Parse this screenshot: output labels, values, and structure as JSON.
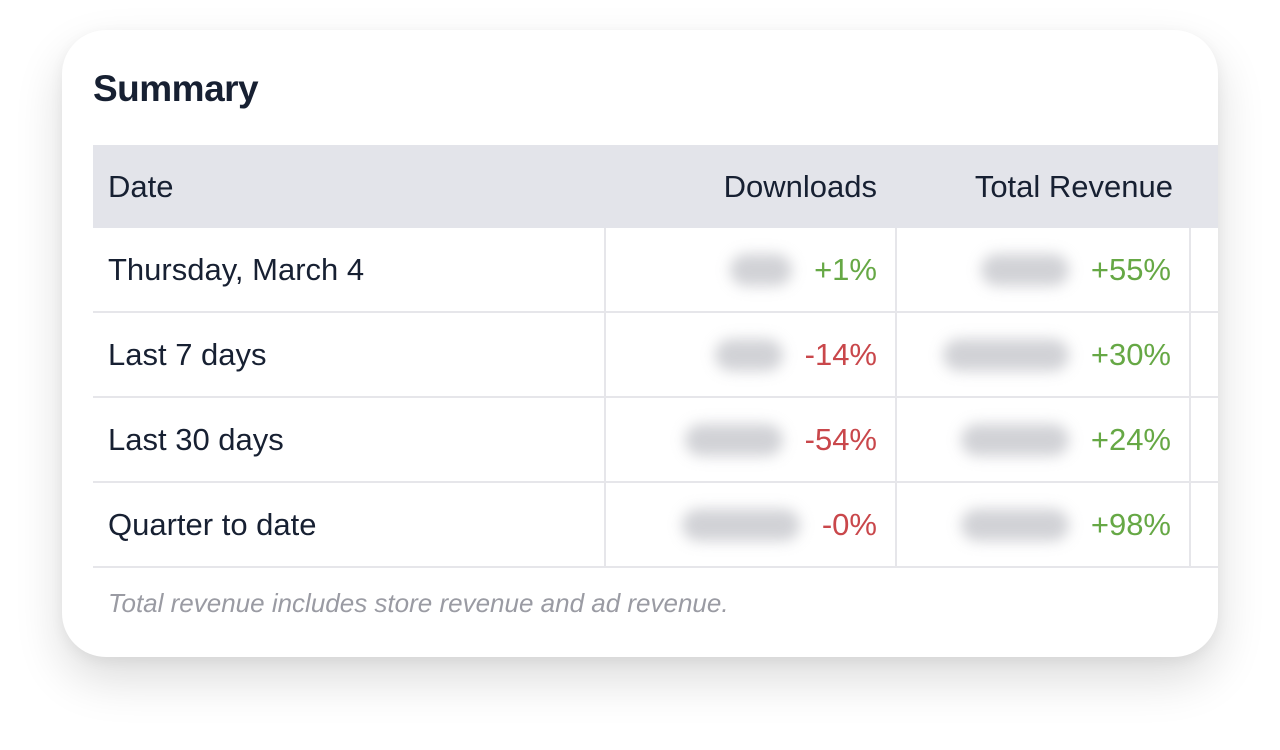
{
  "summary": {
    "title": "Summary",
    "columns": {
      "date": "Date",
      "downloads": "Downloads",
      "total_revenue": "Total Revenue"
    },
    "rows": [
      {
        "date": "Thursday, March 4",
        "downloads_change": "+1%",
        "downloads_trend": "positive",
        "revenue_change": "+55%",
        "revenue_trend": "positive"
      },
      {
        "date": "Last 7 days",
        "downloads_change": "-14%",
        "downloads_trend": "negative",
        "revenue_change": "+30%",
        "revenue_trend": "positive"
      },
      {
        "date": "Last 30 days",
        "downloads_change": "-54%",
        "downloads_trend": "negative",
        "revenue_change": "+24%",
        "revenue_trend": "positive"
      },
      {
        "date": "Quarter to date",
        "downloads_change": "-0%",
        "downloads_trend": "negative",
        "revenue_change": "+98%",
        "revenue_trend": "positive"
      }
    ],
    "footnote": "Total revenue includes store revenue and ad revenue.",
    "colors": {
      "positive": "#66a845",
      "negative": "#c9474b",
      "header_bg": "#e3e4ea",
      "title": "#172032"
    }
  }
}
